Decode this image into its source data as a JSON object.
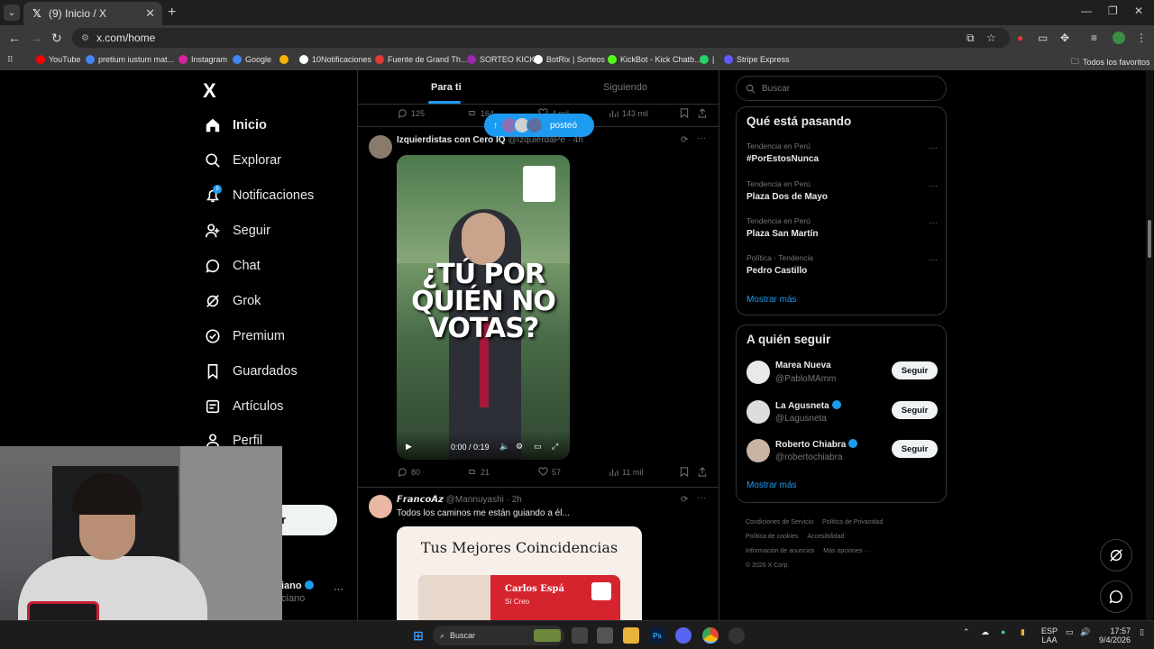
{
  "browser": {
    "tab_title": "(9) Inicio / X",
    "tab_close": "✕",
    "tab_list": "⌄",
    "new_tab": "+",
    "url": "x.com/home",
    "window_controls": {
      "minimize": "—",
      "restore": "❐",
      "close": "✕"
    },
    "bookmarks": [
      {
        "label": "YouTube",
        "color": "#ff0000"
      },
      {
        "label": "pretium iustum mat...",
        "color": "#4285f4"
      },
      {
        "label": "Instagram",
        "color": "#d6249f"
      },
      {
        "label": "Google",
        "color": "#4285f4"
      },
      {
        "label": "",
        "color": "#f4b400"
      },
      {
        "label": "10Notificaciones",
        "color": "#ffffff"
      },
      {
        "label": "Fuente de Grand Th...",
        "color": "#e53935"
      },
      {
        "label": "SORTEO KICK",
        "color": "#9c27b0"
      },
      {
        "label": "BotRix | Sorteos",
        "color": "#ffffff"
      },
      {
        "label": "KickBot - Kick Chatb...",
        "color": "#53fc18"
      },
      {
        "label": "|",
        "color": "#25d366"
      },
      {
        "label": "Stripe Express",
        "color": "#635bff"
      }
    ],
    "all_bookmarks": "Todos los favoritos"
  },
  "sidebar": {
    "logo": "X",
    "items": [
      {
        "label": "Inicio",
        "icon": "home-icon",
        "active": true
      },
      {
        "label": "Explorar",
        "icon": "search-icon"
      },
      {
        "label": "Notificaciones",
        "icon": "bell-icon",
        "badge": "9"
      },
      {
        "label": "Seguir",
        "icon": "follow-icon"
      },
      {
        "label": "Chat",
        "icon": "chat-icon"
      },
      {
        "label": "Grok",
        "icon": "grok-icon"
      },
      {
        "label": "Premium",
        "icon": "premium-icon"
      },
      {
        "label": "Guardados",
        "icon": "bookmark-icon"
      },
      {
        "label": "Artículos",
        "icon": "articles-icon"
      },
      {
        "label": "Perfil",
        "icon": "profile-icon"
      },
      {
        "label": "iones",
        "icon": "more-icon"
      }
    ],
    "post_button": "r",
    "profile": {
      "name": "iano",
      "handle": "ciano",
      "more": "···"
    }
  },
  "timeline": {
    "tabs": [
      {
        "label": "Para ti",
        "active": true
      },
      {
        "label": "Siguiendo",
        "active": false
      }
    ],
    "posted_pill": "posteó",
    "prev_post_actions": {
      "replies": "125",
      "reposts": "164",
      "likes": "4 mil",
      "views": "143 mil"
    },
    "tweet1": {
      "name": "Izquierdistas con Cero IQ",
      "handle": "@IzquierdaPe",
      "time": "· 4h",
      "video_text": "¿TÚ POR QUIÉN NO VOTAS?",
      "video_time": "0:00 / 0:19",
      "actions": {
        "replies": "80",
        "reposts": "21",
        "likes": "57",
        "views": "11 mil"
      }
    },
    "tweet2": {
      "name": "𝙁𝙧𝙖𝙣𝙘𝙤𝘼𝙯",
      "handle": "@Mannuyashi",
      "time": "· 2h",
      "text": "Todos los caminos me están guiando a él...",
      "card_title": "Tus Mejores Coincidencias",
      "card_name": "Carlos Espá",
      "card_sub": "Sí Creo"
    }
  },
  "right": {
    "search_placeholder": "Buscar",
    "trends_title": "Qué está pasando",
    "trends": [
      {
        "context": "Tendencia en Perú",
        "title": "#PorEstosNunca"
      },
      {
        "context": "Tendencia en Perú",
        "title": "Plaza Dos de Mayo"
      },
      {
        "context": "Tendencia en Perú",
        "title": "Plaza San Martín"
      },
      {
        "context": "Política · Tendencia",
        "title": "Pedro Castillo"
      }
    ],
    "trend_more": "···",
    "show_more": "Mostrar más",
    "who_title": "A quién seguir",
    "who": [
      {
        "name": "Marea Nueva",
        "handle": "@PabloMAmm",
        "follow": "Seguir",
        "verified": false
      },
      {
        "name": "La Agusneta",
        "handle": "@Lagusneta",
        "follow": "Seguir",
        "verified": true
      },
      {
        "name": "Roberto Chiabra",
        "handle": "@robertochiabra",
        "follow": "Seguir",
        "verified": true
      }
    ],
    "who_show_more": "Mostrar más",
    "footer": [
      "Condiciones de Servicio",
      "Política de Privacidad",
      "Política de cookies",
      "Accesibilidad",
      "Información de anuncios",
      "Más opciones ···",
      "© 2026 X Corp."
    ]
  },
  "taskbar": {
    "search": "Buscar",
    "lang": "ESP",
    "lang2": "LAA",
    "time": "17:57",
    "date": "9/4/2026"
  }
}
